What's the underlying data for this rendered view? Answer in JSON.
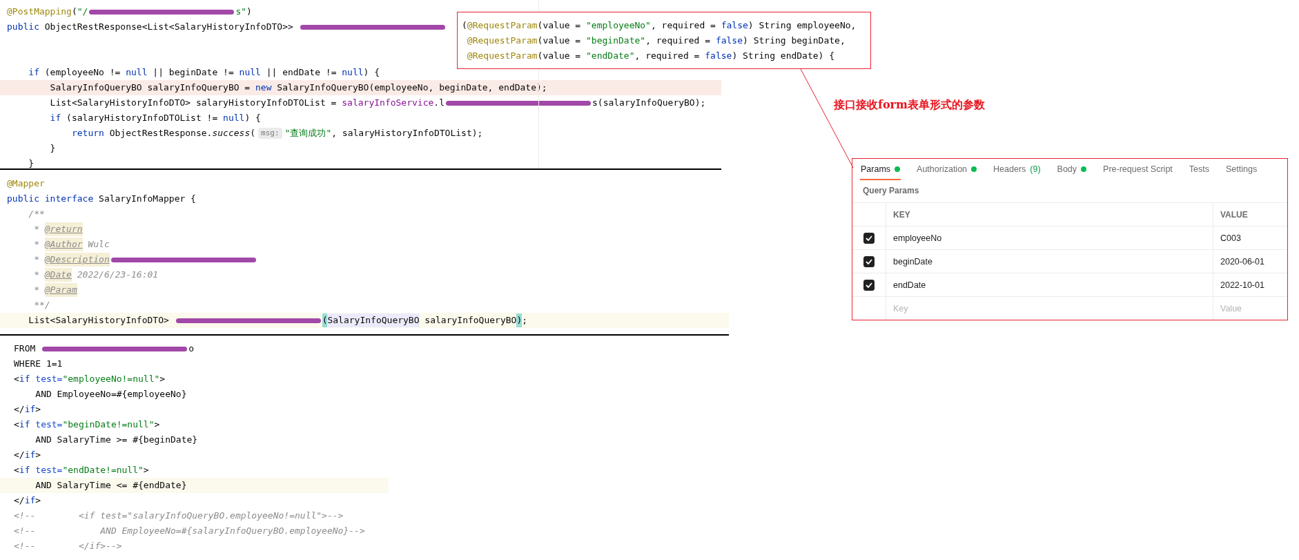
{
  "java_controller": {
    "lines": [
      {
        "kind": "code",
        "tokens": [
          {
            "kind": "annotation",
            "text": "@PostMapping"
          },
          {
            "kind": "plain",
            "text": "("
          },
          {
            "kind": "string",
            "text": "\"/"
          },
          {
            "kind": "redaction"
          },
          {
            "kind": "string",
            "text": "s\""
          },
          {
            "kind": "plain",
            "text": ")"
          }
        ]
      },
      {
        "kind": "code",
        "tokens": [
          {
            "kind": "keyword",
            "text": "public"
          },
          {
            "kind": "plain",
            "text": " ObjectRestResponse<List<SalaryHistoryInfoDTO>> "
          },
          {
            "kind": "redaction"
          }
        ]
      },
      {
        "kind": "blank"
      },
      {
        "kind": "blank"
      },
      {
        "kind": "code",
        "tokens": [
          {
            "kind": "keyword",
            "text": "    if"
          },
          {
            "kind": "plain",
            "text": " (employeeNo != "
          },
          {
            "kind": "keyword",
            "text": "null"
          },
          {
            "kind": "plain",
            "text": " || beginDate != "
          },
          {
            "kind": "keyword",
            "text": "null"
          },
          {
            "kind": "plain",
            "text": " || endDate != "
          },
          {
            "kind": "keyword",
            "text": "null"
          },
          {
            "kind": "plain",
            "text": ") {"
          }
        ]
      },
      {
        "kind": "code",
        "marked": true,
        "tokens": [
          {
            "kind": "plain",
            "text": "        SalaryInfoQueryBO salaryInfoQueryBO = "
          },
          {
            "kind": "keyword",
            "text": "new"
          },
          {
            "kind": "plain",
            "text": " SalaryInfoQueryBO(employeeNo, beginDate, endDate);"
          }
        ]
      },
      {
        "kind": "code",
        "tokens": [
          {
            "kind": "plain",
            "text": "        List<SalaryHistoryInfoDTO> salaryHistoryInfoDTOList = "
          },
          {
            "kind": "field",
            "text": "salaryInfoService"
          },
          {
            "kind": "plain",
            "text": ".l"
          },
          {
            "kind": "redaction"
          },
          {
            "kind": "plain",
            "text": "s(salaryInfoQueryBO);"
          }
        ]
      },
      {
        "kind": "code",
        "tokens": [
          {
            "kind": "keyword",
            "text": "        if"
          },
          {
            "kind": "plain",
            "text": " (salaryHistoryInfoDTOList != "
          },
          {
            "kind": "keyword",
            "text": "null"
          },
          {
            "kind": "plain",
            "text": ") {"
          }
        ]
      },
      {
        "kind": "code",
        "tokens": [
          {
            "kind": "keyword",
            "text": "            return"
          },
          {
            "kind": "plain",
            "text": " ObjectRestResponse."
          },
          {
            "kind": "static",
            "text": "success"
          },
          {
            "kind": "plain",
            "text": "("
          },
          {
            "kind": "hint",
            "text": "msg:"
          },
          {
            "kind": "string",
            "text": "\"查询成功\""
          },
          {
            "kind": "plain",
            "text": ", salaryHistoryInfoDTOList);"
          }
        ]
      },
      {
        "kind": "code",
        "tokens": [
          {
            "kind": "plain",
            "text": "        }"
          }
        ]
      },
      {
        "kind": "code",
        "tokens": [
          {
            "kind": "plain",
            "text": "    }"
          }
        ]
      }
    ],
    "callout": [
      {
        "kind": "code",
        "tokens": [
          {
            "kind": "plain",
            "text": "("
          },
          {
            "kind": "annotation",
            "text": "@RequestParam"
          },
          {
            "kind": "plain",
            "text": "(value = "
          },
          {
            "kind": "string",
            "text": "\"employeeNo\""
          },
          {
            "kind": "plain",
            "text": ", required = "
          },
          {
            "kind": "keyword",
            "text": "false"
          },
          {
            "kind": "plain",
            "text": ") String employeeNo,"
          }
        ]
      },
      {
        "kind": "code",
        "tokens": [
          {
            "kind": "annotation",
            "text": " @RequestParam"
          },
          {
            "kind": "plain",
            "text": "(value = "
          },
          {
            "kind": "string",
            "text": "\"beginDate\""
          },
          {
            "kind": "plain",
            "text": ", required = "
          },
          {
            "kind": "keyword",
            "text": "false"
          },
          {
            "kind": "plain",
            "text": ") String beginDate,"
          }
        ]
      },
      {
        "kind": "code",
        "tokens": [
          {
            "kind": "annotation",
            "text": " @RequestParam"
          },
          {
            "kind": "plain",
            "text": "(value = "
          },
          {
            "kind": "string",
            "text": "\"endDate\""
          },
          {
            "kind": "plain",
            "text": ", required = "
          },
          {
            "kind": "keyword",
            "text": "false"
          },
          {
            "kind": "plain",
            "text": ") String endDate) {"
          }
        ]
      }
    ]
  },
  "java_mapper": {
    "lines": [
      {
        "kind": "code",
        "tokens": [
          {
            "kind": "annotation",
            "text": "@Mapper"
          }
        ]
      },
      {
        "kind": "code",
        "tokens": [
          {
            "kind": "keyword",
            "text": "public interface"
          },
          {
            "kind": "plain",
            "text": " SalaryInfoMapper {"
          }
        ]
      },
      {
        "kind": "code",
        "tokens": [
          {
            "kind": "comment",
            "text": "    /**"
          }
        ]
      },
      {
        "kind": "code",
        "tokens": [
          {
            "kind": "comment",
            "text": "     * "
          },
          {
            "kind": "doc_tag",
            "text": "@return"
          }
        ]
      },
      {
        "kind": "code",
        "tokens": [
          {
            "kind": "comment",
            "text": "     * "
          },
          {
            "kind": "doc_tag",
            "text": "@Author"
          },
          {
            "kind": "comment",
            "text": " Wulc"
          }
        ]
      },
      {
        "kind": "code",
        "tokens": [
          {
            "kind": "comment",
            "text": "     * "
          },
          {
            "kind": "doc_tag",
            "text": "@Description"
          },
          {
            "kind": "redaction"
          }
        ]
      },
      {
        "kind": "code",
        "tokens": [
          {
            "kind": "comment",
            "text": "     * "
          },
          {
            "kind": "doc_tag",
            "text": "@Date"
          },
          {
            "kind": "comment",
            "text": " 2022/6/23-16:01"
          }
        ]
      },
      {
        "kind": "code",
        "tokens": [
          {
            "kind": "comment",
            "text": "     * "
          },
          {
            "kind": "doc_tag",
            "text": "@Param"
          }
        ]
      },
      {
        "kind": "code",
        "tokens": [
          {
            "kind": "comment",
            "text": "     **/"
          }
        ]
      },
      {
        "kind": "code",
        "current": true,
        "tokens": [
          {
            "kind": "plain",
            "text": "    List<SalaryHistoryInfoDTO> "
          },
          {
            "kind": "redaction"
          },
          {
            "kind": "match",
            "text": "("
          },
          {
            "kind": "usage",
            "text": "SalaryInfoQueryBO"
          },
          {
            "kind": "plain",
            "text": " salaryInfoQueryBO"
          },
          {
            "kind": "match",
            "text": ")"
          },
          {
            "kind": "plain",
            "text": ";"
          }
        ]
      }
    ]
  },
  "mybatis_xml": {
    "lines": [
      {
        "kind": "code",
        "tokens": [
          {
            "kind": "plain",
            "text": "FROM "
          },
          {
            "kind": "redaction"
          },
          {
            "kind": "plain",
            "text": "o"
          }
        ]
      },
      {
        "kind": "code",
        "tokens": [
          {
            "kind": "plain",
            "text": "WHERE 1=1"
          }
        ]
      },
      {
        "kind": "code",
        "tokens": [
          {
            "kind": "plain",
            "text": "<"
          },
          {
            "kind": "tag",
            "text": "if"
          },
          {
            "kind": "attr",
            "text": " test="
          },
          {
            "kind": "string",
            "text": "\"employeeNo!=null\""
          },
          {
            "kind": "plain",
            "text": ">"
          }
        ]
      },
      {
        "kind": "code",
        "tokens": [
          {
            "kind": "plain",
            "text": "    AND EmployeeNo=#{employeeNo}"
          }
        ]
      },
      {
        "kind": "code",
        "tokens": [
          {
            "kind": "plain",
            "text": "</"
          },
          {
            "kind": "tag",
            "text": "if"
          },
          {
            "kind": "plain",
            "text": ">"
          }
        ]
      },
      {
        "kind": "code",
        "tokens": [
          {
            "kind": "plain",
            "text": "<"
          },
          {
            "kind": "tag",
            "text": "if"
          },
          {
            "kind": "attr",
            "text": " test="
          },
          {
            "kind": "string",
            "text": "\"beginDate!=null\""
          },
          {
            "kind": "plain",
            "text": ">"
          }
        ]
      },
      {
        "kind": "code",
        "tokens": [
          {
            "kind": "plain",
            "text": "    AND SalaryTime >= #{beginDate}"
          }
        ]
      },
      {
        "kind": "code",
        "tokens": [
          {
            "kind": "plain",
            "text": "</"
          },
          {
            "kind": "tag",
            "text": "if"
          },
          {
            "kind": "plain",
            "text": ">"
          }
        ]
      },
      {
        "kind": "code",
        "tokens": [
          {
            "kind": "plain",
            "text": "<"
          },
          {
            "kind": "tag",
            "text": "if"
          },
          {
            "kind": "attr",
            "text": " test="
          },
          {
            "kind": "string",
            "text": "\"endDate!=null\""
          },
          {
            "kind": "plain",
            "text": ">"
          }
        ]
      },
      {
        "kind": "code",
        "current": true,
        "tokens": [
          {
            "kind": "plain",
            "text": "    AND SalaryTime <= #{endDate}"
          }
        ]
      },
      {
        "kind": "code",
        "tokens": [
          {
            "kind": "plain",
            "text": "</"
          },
          {
            "kind": "tag",
            "text": "if"
          },
          {
            "kind": "plain",
            "text": ">"
          }
        ]
      },
      {
        "kind": "code",
        "tokens": [
          {
            "kind": "comment",
            "text": "<!--        <if test=\"salaryInfoQueryBO.employeeNo!=null\">-->"
          }
        ]
      },
      {
        "kind": "code",
        "tokens": [
          {
            "kind": "comment",
            "text": "<!--            AND EmployeeNo=#{salaryInfoQueryBO.employeeNo}-->"
          }
        ]
      },
      {
        "kind": "code",
        "tokens": [
          {
            "kind": "comment",
            "text": "<!--        </if>-->"
          }
        ]
      }
    ]
  },
  "annotation_note": "接口接收form表单形式的参数",
  "request_panel": {
    "tabs": [
      {
        "label": "Params",
        "dot": true,
        "selected": true
      },
      {
        "label": "Authorization",
        "dot": true,
        "selected": false
      },
      {
        "label": "Headers",
        "count": "(9)",
        "dot": false,
        "selected": false
      },
      {
        "label": "Body",
        "dot": true,
        "selected": false
      },
      {
        "label": "Pre-request Script",
        "dot": false,
        "selected": false
      },
      {
        "label": "Tests",
        "dot": false,
        "selected": false
      },
      {
        "label": "Settings",
        "dot": false,
        "selected": false
      }
    ],
    "section_title": "Query Params",
    "columns": [
      "KEY",
      "VALUE"
    ],
    "rows": [
      {
        "checked": true,
        "key": "employeeNo",
        "value": "C003"
      },
      {
        "checked": true,
        "key": "beginDate",
        "value": "2020-06-01"
      },
      {
        "checked": true,
        "key": "endDate",
        "value": "2022-10-01"
      }
    ],
    "new_row": {
      "key_placeholder": "Key",
      "value_placeholder": "Value"
    }
  }
}
